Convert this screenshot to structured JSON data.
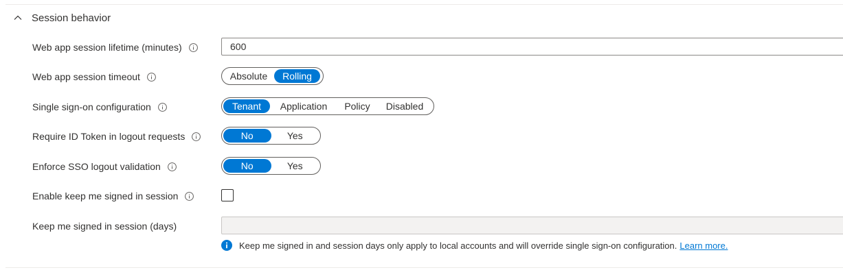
{
  "section": {
    "title": "Session behavior",
    "expanded": true
  },
  "fields": {
    "lifetime": {
      "label": "Web app session lifetime (minutes)",
      "value": "600"
    },
    "timeout": {
      "label": "Web app session timeout",
      "options": [
        "Absolute",
        "Rolling"
      ],
      "selected": "Rolling"
    },
    "sso": {
      "label": "Single sign-on configuration",
      "options": [
        "Tenant",
        "Application",
        "Policy",
        "Disabled"
      ],
      "selected": "Tenant"
    },
    "id_token": {
      "label": "Require ID Token in logout requests",
      "options": [
        "No",
        "Yes"
      ],
      "selected": "No"
    },
    "sso_logout": {
      "label": "Enforce SSO logout validation",
      "options": [
        "No",
        "Yes"
      ],
      "selected": "No"
    },
    "kmsi": {
      "label": "Enable keep me signed in session",
      "checked": false
    },
    "kmsi_days": {
      "label": "Keep me signed in session (days)",
      "value": "",
      "disabled": true
    }
  },
  "note": {
    "text": "Keep me signed in and session days only apply to local accounts and will override single sign-on configuration.",
    "link": "Learn more."
  },
  "colors": {
    "accent": "#0078d4",
    "text": "#323130",
    "border": "#8a8886",
    "disabled_bg": "#f3f2f1"
  },
  "icons": {
    "section_toggle": "chevron-up-icon",
    "field_info": "info-circle-icon",
    "note": "info-filled-icon"
  }
}
